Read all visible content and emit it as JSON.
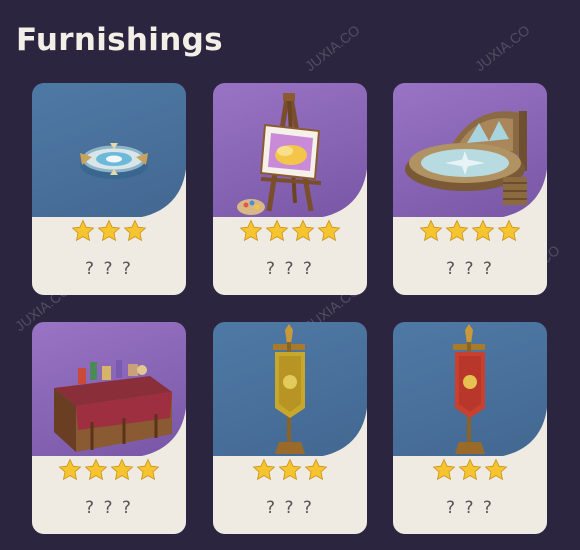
{
  "page": {
    "title": "Furnishings"
  },
  "watermark": "JUXIA.CO",
  "colors": {
    "background": "#2c2540",
    "blue_card": "#4a72a0",
    "purple_card": "#8a64b8",
    "star": "#f6c42e",
    "label_bg": "#efebe3"
  },
  "cards": [
    {
      "name": "? ? ?",
      "rarity": 3,
      "theme": "blue",
      "icon": "compass-ornament-icon"
    },
    {
      "name": "? ? ?",
      "rarity": 4,
      "theme": "purple",
      "icon": "easel-painting-icon"
    },
    {
      "name": "? ? ?",
      "rarity": 4,
      "theme": "purple",
      "icon": "fountain-pavilion-icon"
    },
    {
      "name": "? ? ?",
      "rarity": 4,
      "theme": "purple",
      "icon": "cluttered-desk-icon"
    },
    {
      "name": "? ? ?",
      "rarity": 3,
      "theme": "blue",
      "icon": "yellow-banner-icon"
    },
    {
      "name": "? ? ?",
      "rarity": 3,
      "theme": "blue",
      "icon": "red-banner-icon"
    }
  ]
}
